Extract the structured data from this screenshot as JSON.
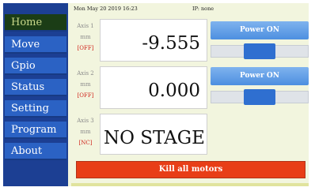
{
  "nav": {
    "items": [
      {
        "label": "Home"
      },
      {
        "label": "Move"
      },
      {
        "label": "Gpio"
      },
      {
        "label": "Status"
      },
      {
        "label": "Setting"
      },
      {
        "label": "Program"
      },
      {
        "label": "About"
      }
    ],
    "active": "Home"
  },
  "status": {
    "datetime": "Mon May 20 2019 16:23",
    "ip": "IP: none"
  },
  "axes": [
    {
      "name": "Axis 1",
      "unit": "mm",
      "state": "[OFF]",
      "value": "-9.555",
      "power_label": "Power ON",
      "slider_level": 0.5
    },
    {
      "name": "Axis 2",
      "unit": "mm",
      "state": "[OFF]",
      "value": "0.000",
      "power_label": "Power ON",
      "slider_level": 0.5
    },
    {
      "name": "Axis 3",
      "unit": "mm",
      "state": "[NC]",
      "value": "NO STAGE"
    }
  ],
  "kill_button": {
    "label": "Kill all motors"
  },
  "colors": {
    "sidebar": "#1c3f93",
    "nav_item": "#2b62c4",
    "nav_active": "#1b3d16",
    "screen_bg": "#f2f5de",
    "power_button": "#5b9be6",
    "kill_button": "#e83e17",
    "state_text": "#d0231b"
  }
}
